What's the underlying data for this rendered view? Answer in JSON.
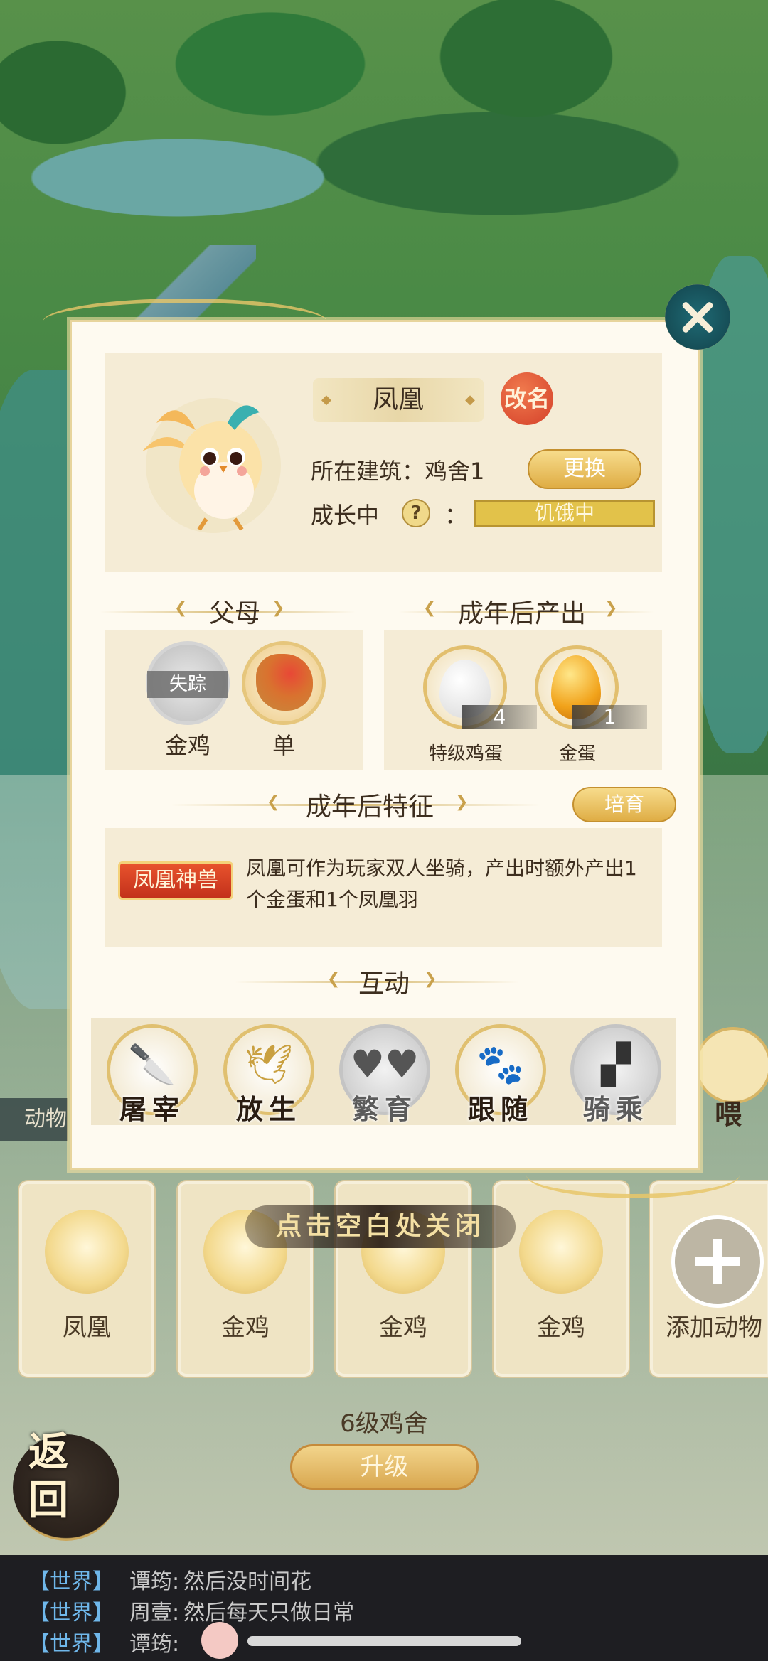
{
  "background": {
    "bottom_left_tab": "动物"
  },
  "modal": {
    "name": "凤凰",
    "rename_label": "改名",
    "building_label": "所在建筑：鸡舍1",
    "change_button": "更换",
    "growing_label": "成长中",
    "help_icon": "?",
    "colon": "：",
    "status": "饥饿中",
    "parents_title": "父母",
    "parents": [
      {
        "name": "金鸡",
        "badge": "失踪",
        "icon": "grey-chicken"
      },
      {
        "name": "单",
        "icon": "rooster"
      }
    ],
    "output_title": "成年后产出",
    "outputs": [
      {
        "name": "特级鸡蛋",
        "count": "4",
        "icon": "white-egg"
      },
      {
        "name": "金蛋",
        "count": "1",
        "icon": "gold-egg"
      }
    ],
    "traits_title": "成年后特征",
    "train_button": "培育",
    "trait_badge": "凤凰神兽",
    "trait_desc": "凤凰可作为玩家双人坐骑，产出时额外产出1个金蛋和1个凤凰羽",
    "interact_title": "互动",
    "actions": [
      {
        "label": "屠宰",
        "icon": "cleaver-icon",
        "enabled": true
      },
      {
        "label": "放生",
        "icon": "bird-icon",
        "enabled": true
      },
      {
        "label": "繁育",
        "icon": "hearts-icon",
        "enabled": false
      },
      {
        "label": "跟随",
        "icon": "pawprints-icon",
        "enabled": true
      },
      {
        "label": "骑乘",
        "icon": "saddle-icon",
        "enabled": false
      }
    ],
    "feed_label": "喂"
  },
  "close_hint": "点击空白处关闭",
  "animals": [
    {
      "name": "凤凰"
    },
    {
      "name": "金鸡"
    },
    {
      "name": "金鸡"
    },
    {
      "name": "金鸡"
    },
    {
      "name": "添加动物"
    }
  ],
  "coop": {
    "level_label": "6级鸡舍",
    "upgrade_label": "升级"
  },
  "back_label": "返回",
  "chat": [
    {
      "channel": "【世界】",
      "user": "谭筠:",
      "text": "然后没时间花"
    },
    {
      "channel": "【世界】",
      "user": "周壹:",
      "text": "然后每天只做日常"
    },
    {
      "channel": "【世界】",
      "user": "谭筠:",
      "text": ""
    }
  ]
}
